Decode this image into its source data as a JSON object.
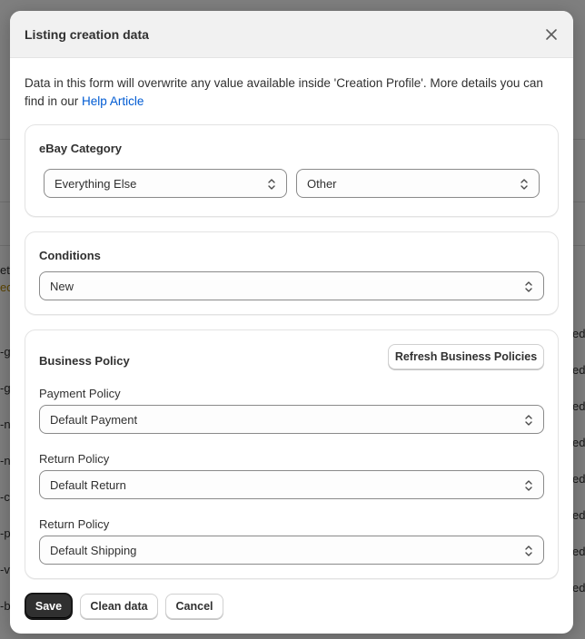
{
  "background": {
    "left_fragments": [
      "et",
      "ed",
      "-g",
      "-g",
      "-n",
      "-n",
      "-c",
      "-p",
      "-v",
      "-b"
    ],
    "right_fragments": [
      "ed",
      "ed",
      "ed",
      "ed",
      "ed",
      "ed",
      "ed",
      "ed"
    ]
  },
  "modal": {
    "title": "Listing creation data",
    "close_icon": "close-icon",
    "intro_text": "Data in this form will overwrite any value available inside 'Creation Profile'. More details you can find in our ",
    "help_link": "Help Article",
    "ebay_category": {
      "title": "eBay Category",
      "primary_value": "Everything Else",
      "secondary_value": "Other"
    },
    "conditions": {
      "title": "Conditions",
      "value": "New"
    },
    "business_policy": {
      "title": "Business Policy",
      "refresh_label": "Refresh Business Policies",
      "payment_label": "Payment Policy",
      "payment_value": "Default Payment",
      "return_label": "Return Policy",
      "return_value": "Default Return",
      "shipping_label": "Return Policy",
      "shipping_value": "Default Shipping"
    },
    "footer": {
      "save_label": "Save",
      "clean_label": "Clean data",
      "cancel_label": "Cancel"
    }
  }
}
